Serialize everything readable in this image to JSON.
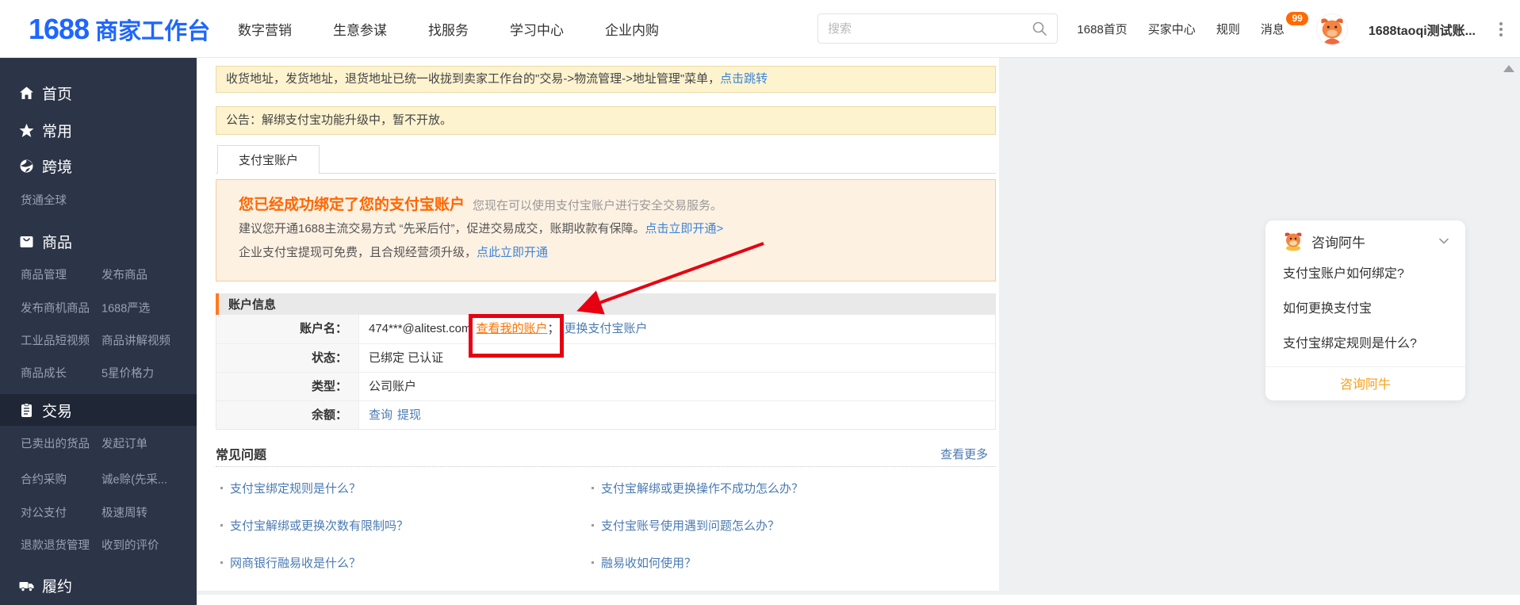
{
  "header": {
    "logo_number": "1688",
    "logo_text": "商家工作台",
    "nav": [
      "数字营销",
      "生意参谋",
      "找服务",
      "学习中心",
      "企业内购"
    ],
    "search_placeholder": "搜索",
    "home_link": "1688首页",
    "buyer_center": "买家中心",
    "rules": "规则",
    "messages": "消息",
    "message_count": "99",
    "username": "1688taoqi测试账..."
  },
  "sidebar": {
    "sections": [
      {
        "icon": "home-icon",
        "label": "首页"
      },
      {
        "icon": "star-icon",
        "label": "常用"
      },
      {
        "icon": "globe-icon",
        "label": "跨境",
        "subs": [
          [
            "货通全球",
            ""
          ]
        ]
      },
      {
        "icon": "bag-icon",
        "label": "商品",
        "subs": [
          [
            "商品管理",
            "发布商品"
          ],
          [
            "发布商机商品",
            "1688严选"
          ],
          [
            "工业品短视频",
            "商品讲解视频"
          ],
          [
            "商品成长",
            "5星价格力"
          ]
        ]
      },
      {
        "icon": "clipboard-icon",
        "label": "交易",
        "active": true,
        "subs": [
          [
            "已卖出的货品",
            "发起订单"
          ],
          [
            "合约采购",
            "诚e赊(先采..."
          ],
          [
            "对公支付",
            "极速周转"
          ],
          [
            "退款退货管理",
            "收到的评价"
          ]
        ]
      },
      {
        "icon": "truck-icon",
        "label": "履约"
      }
    ]
  },
  "notices": {
    "address_text": "收货地址，发货地址，退货地址已统一收拢到卖家工作台的\"交易->物流管理->地址管理\"菜单，",
    "address_link": "点击跳转",
    "announcement": "公告：解绑支付宝功能升级中，暂不开放。"
  },
  "tab": {
    "label": "支付宝账户"
  },
  "bind_box": {
    "title": "您已经成功绑定了您的支付宝账户",
    "subtitle": "您现在可以使用支付宝账户进行安全交易服务。",
    "line2_text": "建议您开通1688主流交易方式 “先采后付”，促进交易成交，账期收款有保障。",
    "line2_link": "点击立即开通>",
    "line3_text": "企业支付宝提现可免费，且合规经营须升级，",
    "line3_link": "点此立即开通"
  },
  "account": {
    "title": "账户信息",
    "rows": [
      {
        "label": "账户名：",
        "value": "474***@alitest.com",
        "view_link": "查看我的账户",
        "separator": "；",
        "change_link": "更换支付宝账户"
      },
      {
        "label": "状态：",
        "value": "已绑定 已认证"
      },
      {
        "label": "类型：",
        "value": "公司账户"
      },
      {
        "label": "余额：",
        "link1": "查询",
        "link2": "提现"
      }
    ]
  },
  "faq": {
    "title": "常见问题",
    "more": "查看更多",
    "left": [
      "支付宝绑定规则是什么？",
      "支付宝解绑或更换次数有限制吗？",
      "网商银行融易收是什么？"
    ],
    "right": [
      "支付宝解绑或更换操作不成功怎么办？",
      "支付宝账号使用遇到问题怎么办？",
      "融易收如何使用？"
    ]
  },
  "consult_card": {
    "title": "咨询阿牛",
    "items": [
      "支付宝账户如何绑定?",
      "如何更换支付宝",
      "支付宝绑定规则是什么?"
    ],
    "action": "咨询阿牛"
  },
  "colors": {
    "brand_blue": "#1e66ff",
    "accent_orange": "#ff6600",
    "badge_orange": "#ff6a00",
    "notice_bg": "#fdf3cf",
    "notice_border": "#eed9a4",
    "bind_bg": "#fdf1e2",
    "bind_border": "#f3cda0",
    "sidebar_bg": "#2c3447",
    "annotation_red": "#e60012",
    "link_bright": "#3d85d8",
    "link_steel": "#4a7ab2"
  }
}
